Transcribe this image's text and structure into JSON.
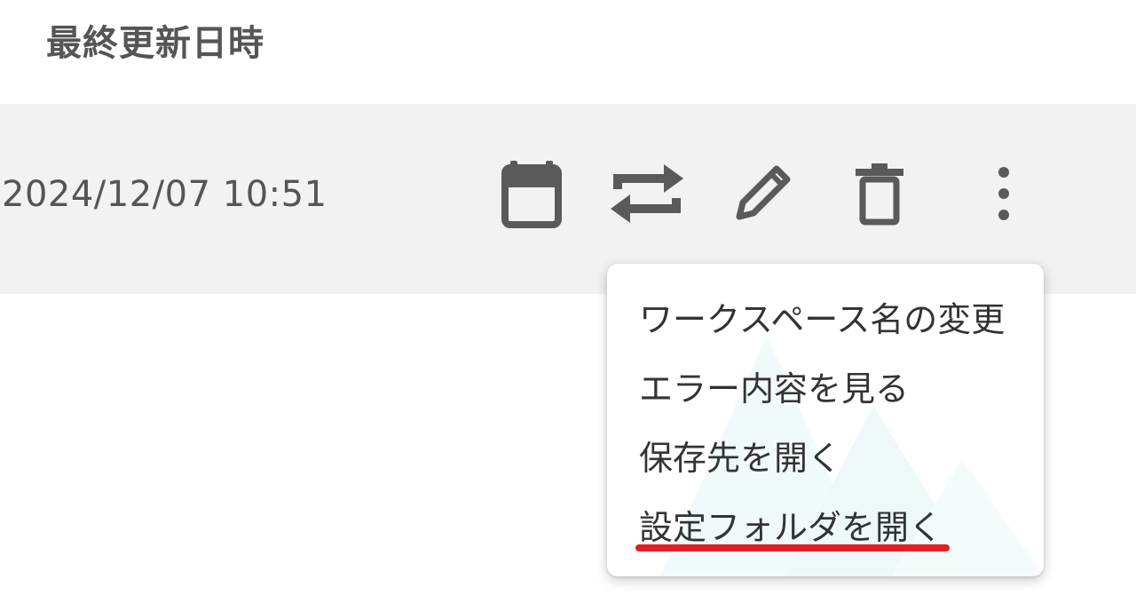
{
  "header": {
    "last_updated_label": "最終更新日時"
  },
  "row": {
    "last_updated": "2024/12/07 10:51"
  },
  "actions": [
    {
      "icon": "calendar-icon"
    },
    {
      "icon": "sync-icon"
    },
    {
      "icon": "edit-icon"
    },
    {
      "icon": "trash-icon"
    },
    {
      "icon": "more-vert-icon"
    }
  ],
  "menu": {
    "items": [
      {
        "label": "ワークスペース名の変更"
      },
      {
        "label": "エラー内容を見る"
      },
      {
        "label": "保存先を開く"
      },
      {
        "label": "設定フォルダを開く",
        "highlighted": true
      }
    ]
  },
  "colors": {
    "row_background": "#f2f2f2",
    "icon": "#5a5a5a",
    "highlight_underline": "#e31e24"
  }
}
